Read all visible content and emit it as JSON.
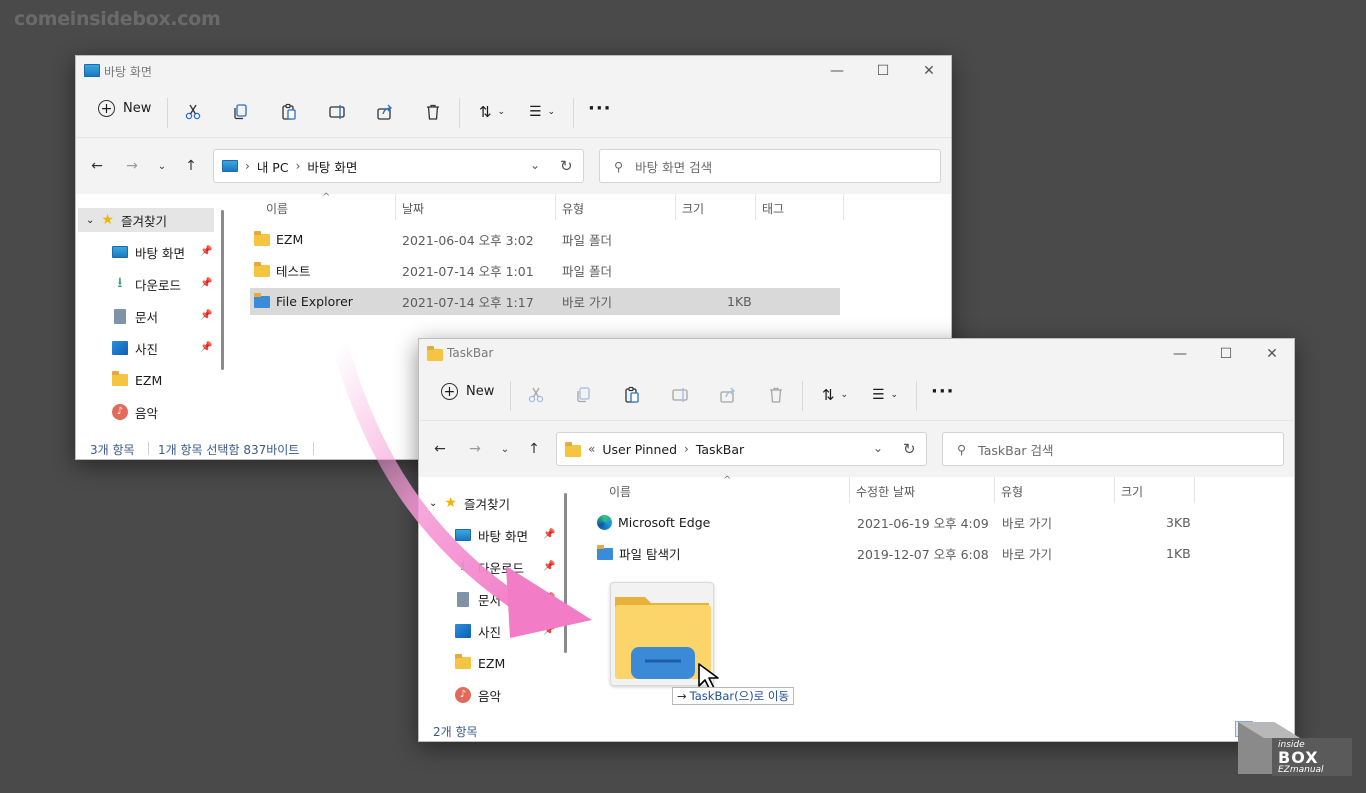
{
  "watermark": "comeinsidebox.com",
  "window1": {
    "title": "바탕 화면",
    "toolbar": {
      "new_label": "New"
    },
    "address": {
      "crumbs": [
        "내 PC",
        "바탕 화면"
      ]
    },
    "search_placeholder": "바탕 화면 검색",
    "sidebar": {
      "items": [
        {
          "label": "즐겨찾기",
          "icon": "star-icon"
        },
        {
          "label": "바탕 화면",
          "icon": "desktop-icon"
        },
        {
          "label": "다운로드",
          "icon": "download-icon"
        },
        {
          "label": "문서",
          "icon": "document-icon"
        },
        {
          "label": "사진",
          "icon": "picture-icon"
        },
        {
          "label": "EZM",
          "icon": "folder-icon"
        },
        {
          "label": "음악",
          "icon": "music-icon"
        }
      ]
    },
    "columns": [
      "이름",
      "날짜",
      "유형",
      "크기",
      "태그"
    ],
    "rows": [
      {
        "name": "EZM",
        "date": "2021-06-04 오후 3:02",
        "type": "파일 폴더",
        "size": ""
      },
      {
        "name": "테스트",
        "date": "2021-07-14 오후 1:01",
        "type": "파일 폴더",
        "size": ""
      },
      {
        "name": "File Explorer",
        "date": "2021-07-14 오후 1:17",
        "type": "바로 가기",
        "size": "1KB"
      }
    ],
    "status": {
      "count": "3개 항목",
      "selection": "1개 항목 선택함 837바이트"
    }
  },
  "window2": {
    "title": "TaskBar",
    "toolbar": {
      "new_label": "New"
    },
    "address": {
      "prefix": "«",
      "crumbs": [
        "User Pinned",
        "TaskBar"
      ]
    },
    "search_placeholder": "TaskBar 검색",
    "sidebar": {
      "items": [
        {
          "label": "즐겨찾기",
          "icon": "star-icon"
        },
        {
          "label": "바탕 화면",
          "icon": "desktop-icon"
        },
        {
          "label": "다운로드",
          "icon": "download-icon"
        },
        {
          "label": "문서",
          "icon": "document-icon"
        },
        {
          "label": "사진",
          "icon": "picture-icon"
        },
        {
          "label": "EZM",
          "icon": "folder-icon"
        },
        {
          "label": "음악",
          "icon": "music-icon"
        }
      ]
    },
    "columns": [
      "이름",
      "수정한 날짜",
      "유형",
      "크기"
    ],
    "rows": [
      {
        "name": "Microsoft Edge",
        "date": "2021-06-19 오후 4:09",
        "type": "바로 가기",
        "size": "3KB"
      },
      {
        "name": "파일 탐색기",
        "date": "2019-12-07 오후 6:08",
        "type": "바로 가기",
        "size": "1KB"
      }
    ],
    "status": {
      "count": "2개 항목"
    }
  },
  "drag": {
    "label": "TaskBar(으)로 이동",
    "arrow": "→"
  },
  "badge": {
    "line1": "inside",
    "line2": "BOX",
    "line3": "EZmanual"
  },
  "colors": {
    "drag_arrow": "#f59ad6",
    "folder": "#f5c542",
    "selection": "#d9d9d9",
    "status_text": "#3a5a8a"
  }
}
